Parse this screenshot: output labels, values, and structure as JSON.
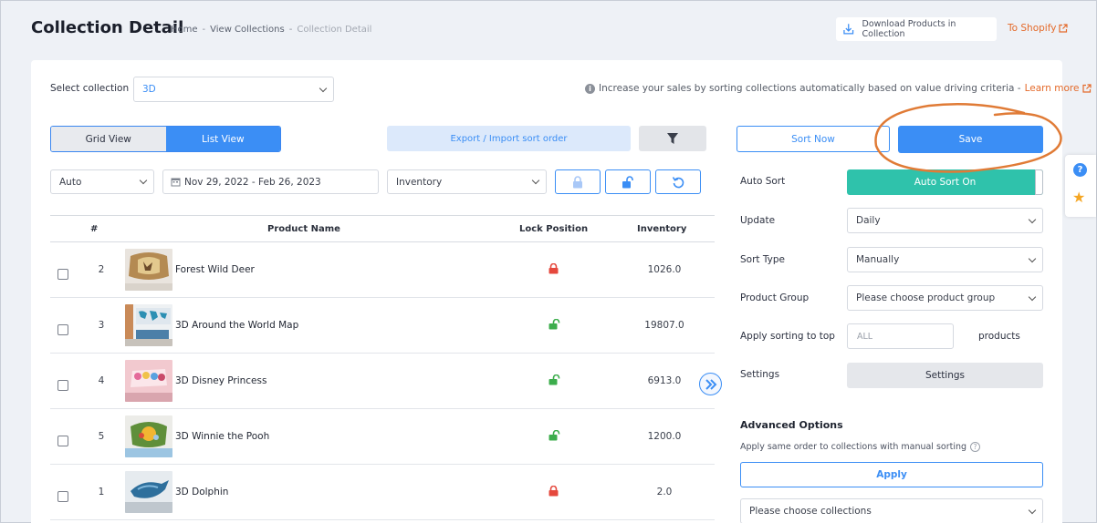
{
  "header": {
    "title": "Collection Detail",
    "breadcrumb": [
      "Home",
      "View Collections",
      "Collection Detail"
    ],
    "breadcrumb_sep": "-",
    "download_label": "Download Products in Collection",
    "to_shopify_label": "To Shopify"
  },
  "filters": {
    "select_collection_label": "Select collection",
    "collection_value": "3D",
    "tip_text": "Increase your sales by sorting collections automatically based on value driving criteria -",
    "learn_more": "Learn more",
    "grid_view": "Grid View",
    "list_view": "List View",
    "export_label": "Export / Import sort order",
    "mode_value": "Auto",
    "date_range": "Nov 29, 2022 - Feb 26, 2023",
    "metric_value": "Inventory"
  },
  "table": {
    "headers": [
      "#",
      "Product Name",
      "Lock Position",
      "Inventory"
    ],
    "rows": [
      {
        "num": "2",
        "name": "Forest Wild Deer",
        "locked": true,
        "inventory": "1026.0"
      },
      {
        "num": "3",
        "name": "3D Around the World Map",
        "locked": false,
        "inventory": "19807.0"
      },
      {
        "num": "4",
        "name": "3D Disney Princess",
        "locked": false,
        "inventory": "6913.0"
      },
      {
        "num": "5",
        "name": "3D Winnie the Pooh",
        "locked": false,
        "inventory": "1200.0"
      },
      {
        "num": "1",
        "name": "3D Dolphin",
        "locked": true,
        "inventory": "2.0"
      }
    ]
  },
  "panel": {
    "sort_now": "Sort Now",
    "save": "Save",
    "auto_sort_label": "Auto Sort",
    "auto_sort_value": "Auto Sort On",
    "update_label": "Update",
    "update_value": "Daily",
    "sort_type_label": "Sort Type",
    "sort_type_value": "Manually",
    "product_group_label": "Product Group",
    "product_group_value": "Please choose product group",
    "apply_top_label": "Apply sorting to top",
    "apply_top_placeholder": "ALL",
    "products_label": "products",
    "settings_label": "Settings",
    "settings_button": "Settings",
    "advanced_title": "Advanced Options",
    "advanced_sub": "Apply same order to collections with manual sorting",
    "apply_button": "Apply",
    "choose_collections": "Please choose collections"
  },
  "colors": {
    "accent": "#3b8ef5",
    "autosort_on": "#2fc2ab",
    "locked": "#e5483d",
    "unlocked": "#3cad4c",
    "link_orange": "#e46a2a",
    "annotation": "#e07b36"
  }
}
